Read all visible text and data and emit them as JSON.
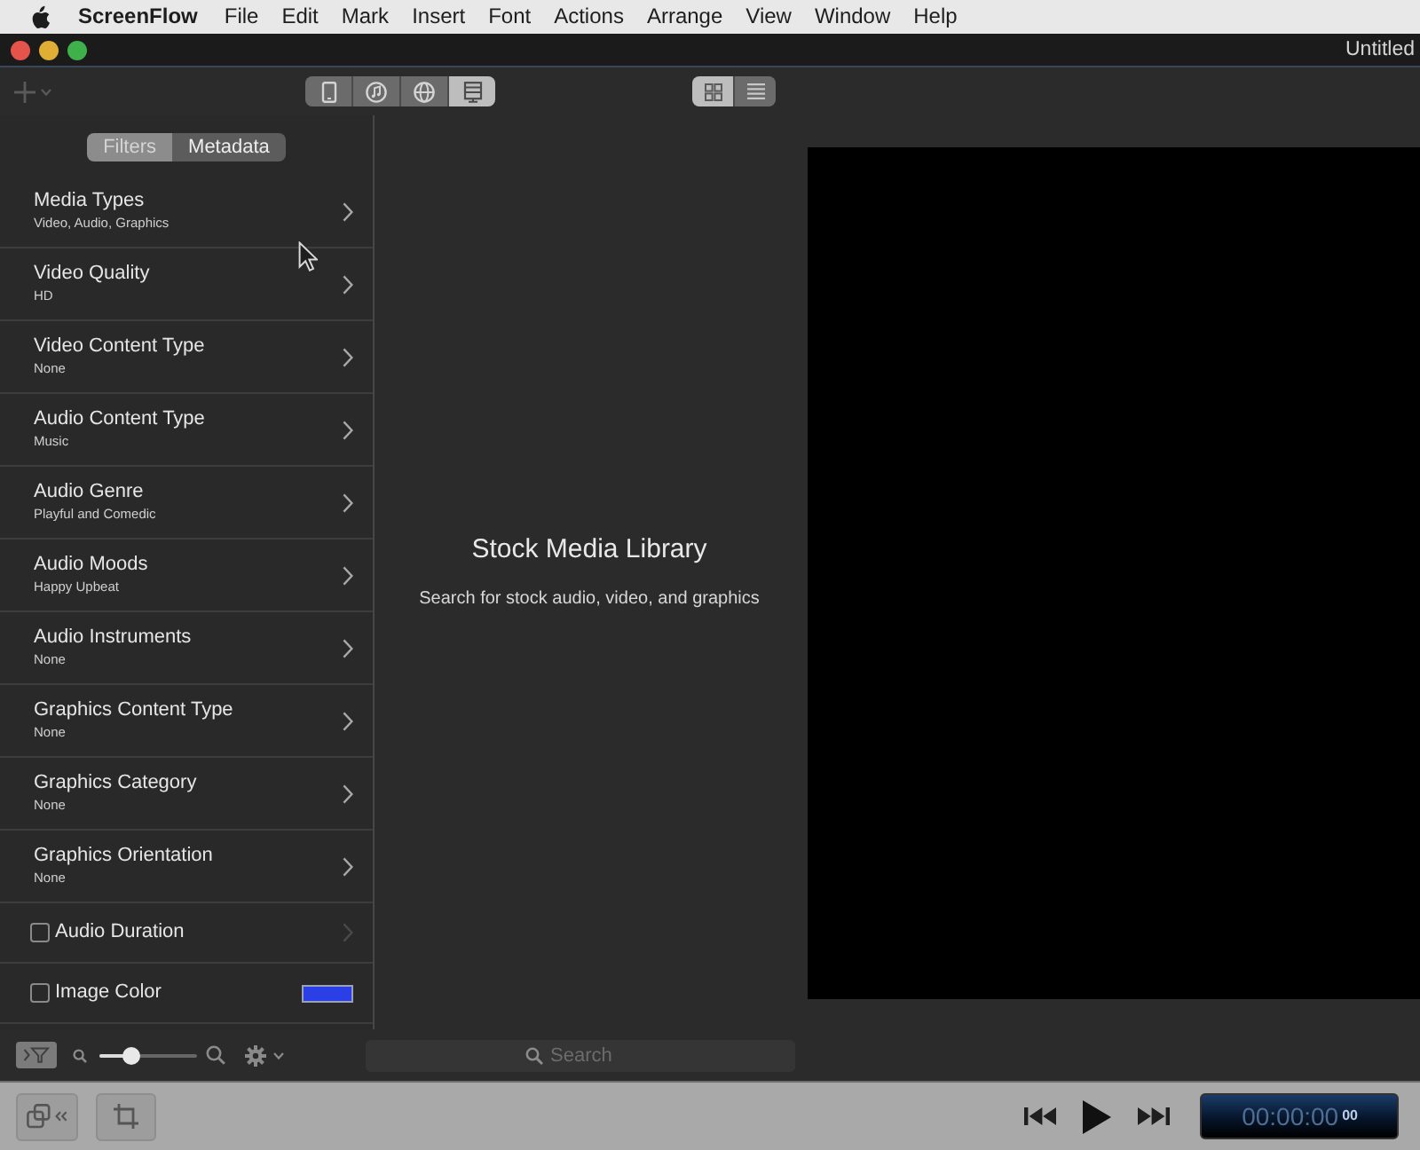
{
  "menu_bar": {
    "app_name": "ScreenFlow",
    "items": [
      "File",
      "Edit",
      "Mark",
      "Insert",
      "Font",
      "Actions",
      "Arrange",
      "View",
      "Window",
      "Help"
    ]
  },
  "window": {
    "title": "Untitled"
  },
  "toolbar": {
    "source_tabs": [
      {
        "kind": "device",
        "selected": false
      },
      {
        "kind": "music",
        "selected": false
      },
      {
        "kind": "globe",
        "selected": false
      },
      {
        "kind": "stock",
        "selected": true
      }
    ],
    "view_modes": [
      {
        "kind": "grid",
        "selected": true
      },
      {
        "kind": "list",
        "selected": false
      }
    ]
  },
  "panel_tabs": [
    {
      "label": "Filters",
      "selected": true
    },
    {
      "label": "Metadata",
      "selected": false
    }
  ],
  "filters": [
    {
      "kind": "menu",
      "title": "Media Types",
      "value": "Video, Audio, Graphics"
    },
    {
      "kind": "menu",
      "title": "Video Quality",
      "value": "HD"
    },
    {
      "kind": "menu",
      "title": "Video Content Type",
      "value": "None"
    },
    {
      "kind": "menu",
      "title": "Audio Content Type",
      "value": "Music"
    },
    {
      "kind": "menu",
      "title": "Audio Genre",
      "value": "Playful and Comedic"
    },
    {
      "kind": "menu",
      "title": "Audio Moods",
      "value": "Happy Upbeat"
    },
    {
      "kind": "menu",
      "title": "Audio Instruments",
      "value": "None"
    },
    {
      "kind": "menu",
      "title": "Graphics Content Type",
      "value": "None"
    },
    {
      "kind": "menu",
      "title": "Graphics Category",
      "value": "None"
    },
    {
      "kind": "menu",
      "title": "Graphics Orientation",
      "value": "None"
    },
    {
      "kind": "checkbox",
      "title": "Audio Duration",
      "checked": false,
      "disabled": true
    },
    {
      "kind": "color",
      "title": "Image Color",
      "checked": false,
      "color": "#2b3fe6"
    }
  ],
  "library": {
    "title": "Stock Media Library",
    "subtitle": "Search for stock audio, video, and graphics"
  },
  "browser_toolbar": {
    "zoom_slider": {
      "level": 0.33
    },
    "search": {
      "placeholder": "Search"
    }
  },
  "transport": {
    "timecode": "00:00:00",
    "frames": "00"
  }
}
